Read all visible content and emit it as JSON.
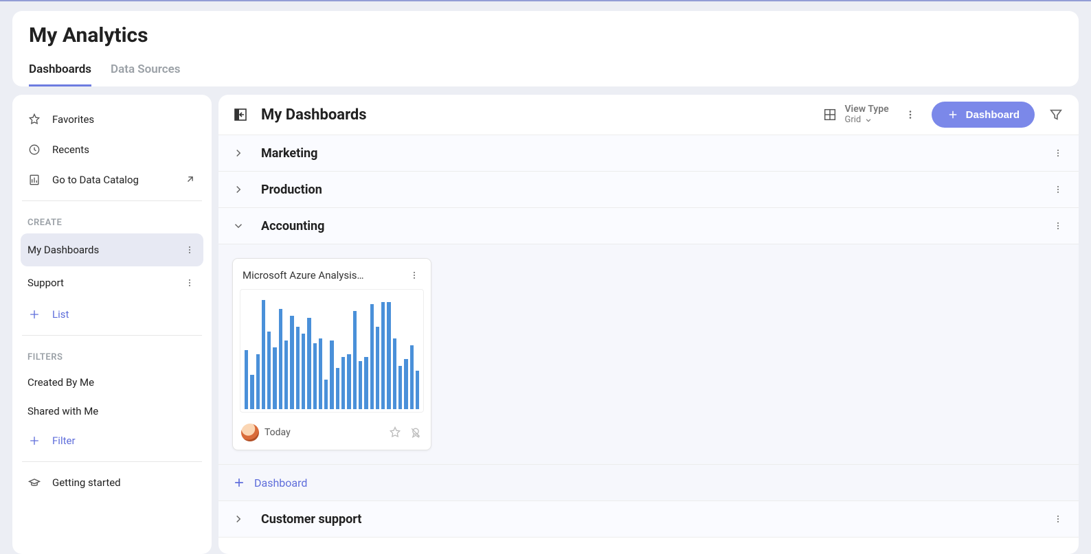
{
  "header": {
    "title": "My Analytics",
    "tabs": [
      "Dashboards",
      "Data Sources"
    ],
    "active_tab": 0
  },
  "sidebar": {
    "top": [
      {
        "label": "Favorites"
      },
      {
        "label": "Recents"
      },
      {
        "label": "Go to Data Catalog"
      }
    ],
    "sections": {
      "create_label": "CREATE",
      "create_items": [
        {
          "label": "My Dashboards",
          "active": true
        },
        {
          "label": "Support"
        }
      ],
      "add_list_label": "List",
      "filters_label": "FILTERS",
      "filter_items": [
        {
          "label": "Created By Me"
        },
        {
          "label": "Shared with Me"
        }
      ],
      "add_filter_label": "Filter"
    },
    "footer": {
      "label": "Getting started"
    }
  },
  "main": {
    "title": "My Dashboards",
    "viewtype_label": "View Type",
    "viewtype_value": "Grid",
    "new_button": "Dashboard",
    "folders": [
      {
        "name": "Marketing",
        "expanded": false
      },
      {
        "name": "Production",
        "expanded": false
      },
      {
        "name": "Accounting",
        "expanded": true
      },
      {
        "name": "Customer support",
        "expanded": false
      }
    ],
    "card": {
      "title": "Microsoft Azure Analysis…",
      "time": "Today"
    },
    "add_dashboard_label": "Dashboard"
  },
  "chart_data": {
    "type": "bar",
    "title": "Microsoft Azure Analysis…",
    "xlabel": "",
    "ylabel": "",
    "ylim": [
      0,
      100
    ],
    "values": [
      52,
      30,
      48,
      96,
      68,
      54,
      88,
      60,
      82,
      72,
      66,
      80,
      58,
      62,
      26,
      60,
      36,
      46,
      48,
      86,
      42,
      46,
      92,
      72,
      94,
      94,
      62,
      38,
      44,
      56,
      34
    ]
  }
}
